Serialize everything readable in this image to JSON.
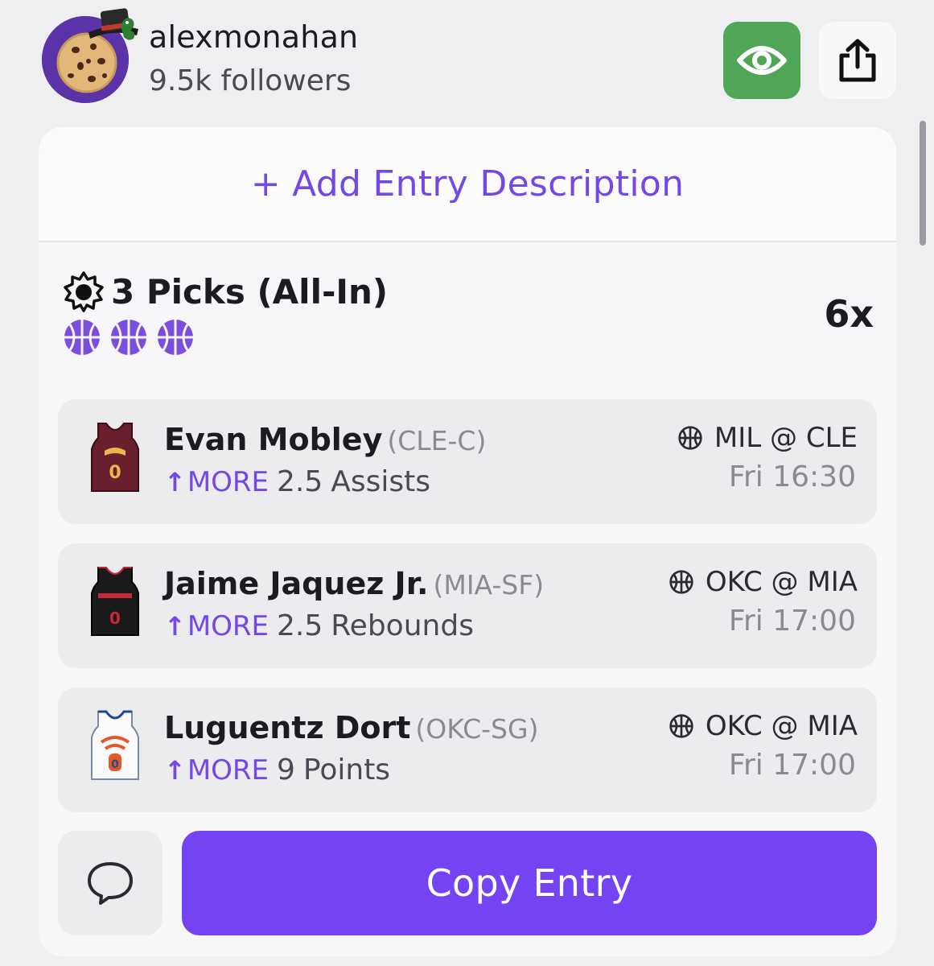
{
  "header": {
    "username": "alexmonahan",
    "followers": "9.5k followers",
    "follow_icon": "eye-icon",
    "share_icon": "share-icon"
  },
  "card": {
    "add_description": "+ Add Entry Description",
    "picks_title": "3 Picks (All-In)",
    "multiplier": "6x",
    "sport_icon": "basketball-icon",
    "picks": [
      {
        "player": "Evan Mobley",
        "position": "(CLE-C)",
        "direction": "MORE",
        "line": "2.5",
        "stat": "Assists",
        "game": "MIL @ CLE",
        "time": "Fri 16:30",
        "jersey_number": "0"
      },
      {
        "player": "Jaime Jaquez Jr.",
        "position": "(MIA-SF)",
        "direction": "MORE",
        "line": "2.5",
        "stat": "Rebounds",
        "game": "OKC @ MIA",
        "time": "Fri 17:00",
        "jersey_number": "0"
      },
      {
        "player": "Luguentz Dort",
        "position": "(OKC-SG)",
        "direction": "MORE",
        "line": "9",
        "stat": "Points",
        "game": "OKC @ MIA",
        "time": "Fri 17:00",
        "jersey_number": "0"
      }
    ],
    "copy_entry": "Copy Entry"
  },
  "colors": {
    "accent": "#7443f2",
    "follow_green": "#4fa657",
    "background": "#efeff1"
  }
}
